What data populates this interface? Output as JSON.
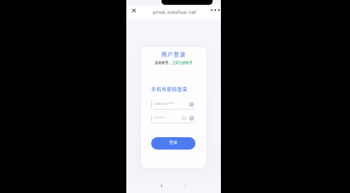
{
  "browser": {
    "url": "pmsk.zukefuai.net",
    "close_icon": "close-icon",
    "more_icon": "more-icon",
    "back_icon": "chevron-left-icon",
    "forward_icon": "chevron-right-icon"
  },
  "login": {
    "title": "用户登录",
    "subtitle_prefix": "没有账号，",
    "subtitle_link": "立即注册账号",
    "section_title": "手机号密码登录",
    "phone_value": "1365772****",
    "password_value": "••••••",
    "submit_label": "登录"
  },
  "colors": {
    "accent": "#3b6de0",
    "button": "#4d7cf1",
    "link": "#1fa36a"
  }
}
